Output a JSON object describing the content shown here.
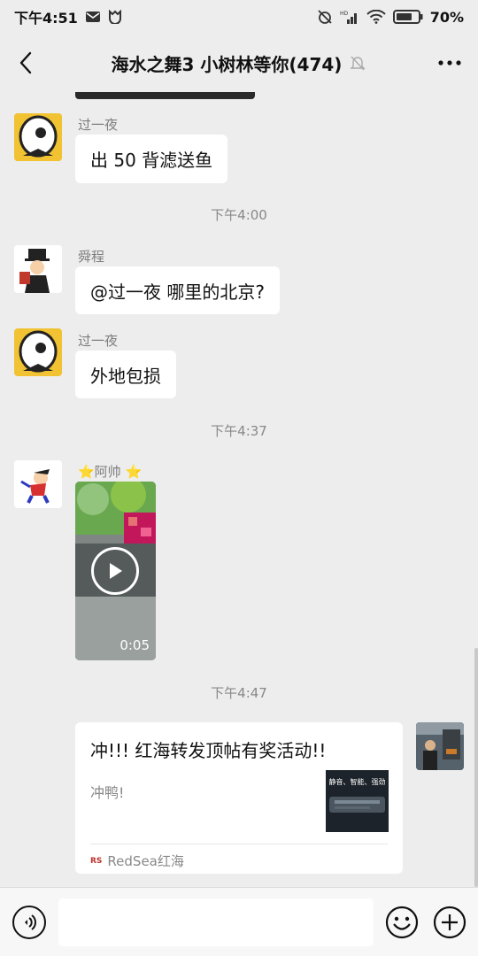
{
  "status_bar": {
    "time": "下午4:51",
    "battery_percent": "70%"
  },
  "header": {
    "title": "海水之舞3 小树林等你(474)"
  },
  "messages": [
    {
      "sender": "过一夜",
      "text": "出 50 背滤送鱼"
    },
    {
      "time": "下午4:00"
    },
    {
      "sender": "舜程",
      "text": "@过一夜  哪里的北京?"
    },
    {
      "sender": "过一夜",
      "text": "外地包损"
    },
    {
      "time": "下午4:37"
    },
    {
      "sender": "⭐阿帅 ⭐",
      "video_duration": "0:05"
    },
    {
      "time": "下午4:47"
    },
    {
      "link_card": {
        "title": "冲!!! 红海转发顶帖有奖活动!!",
        "description": "冲鸭!",
        "thumb_text": "静音、智能、强劲",
        "source": "RedSea红海"
      }
    }
  ],
  "input_bar": {
    "placeholder": ""
  },
  "colors": {
    "background": "#EDEDED",
    "bubble": "#FFFFFF",
    "timestamp": "#888888"
  },
  "icons": [
    "back-icon",
    "mute-bell-icon",
    "more-icon",
    "play-icon",
    "voice-icon",
    "emoji-icon",
    "plus-icon"
  ]
}
